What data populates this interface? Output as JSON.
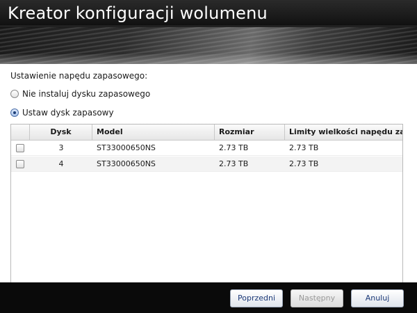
{
  "window": {
    "title": "Kreator konfiguracji wolumenu"
  },
  "spare": {
    "section_label": "Ustawienie napędu zapasowego:",
    "options": [
      {
        "label": "Nie instaluj dysku zapasowego",
        "selected": false
      },
      {
        "label": "Ustaw dysk zapasowy",
        "selected": true
      }
    ]
  },
  "table": {
    "columns": [
      "",
      "Dysk",
      "Model",
      "Rozmiar",
      "Limity wielkości napędu zapasowego"
    ],
    "rows": [
      {
        "checked": false,
        "disk": "3",
        "model": "ST33000650NS",
        "size": "2.73 TB",
        "limit": "2.73 TB"
      },
      {
        "checked": false,
        "disk": "4",
        "model": "ST33000650NS",
        "size": "2.73 TB",
        "limit": "2.73 TB"
      }
    ]
  },
  "footer": {
    "prev_label": "Poprzedni",
    "next_label": "Następny",
    "next_enabled": false,
    "cancel_label": "Anuluj"
  },
  "colors": {
    "header_bg": "#111111",
    "button_text": "#1d3a78",
    "disabled_text": "#9a9a9a"
  }
}
